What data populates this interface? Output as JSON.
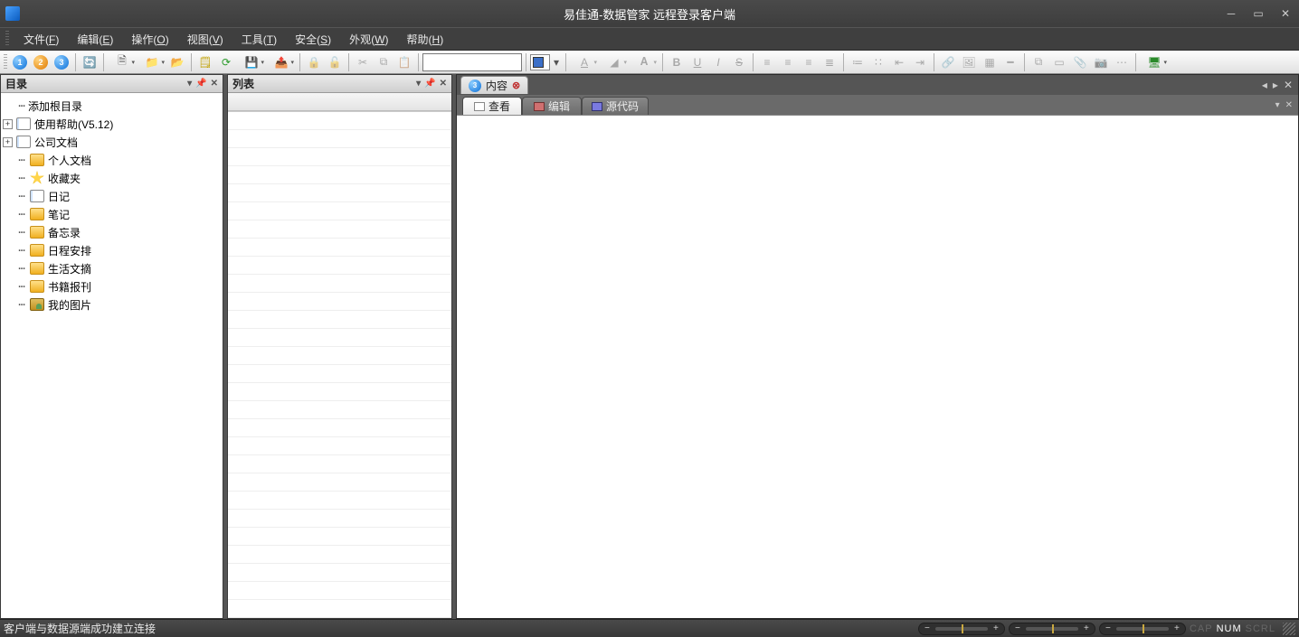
{
  "window": {
    "title": "易佳通-数据管家 远程登录客户端"
  },
  "menu": {
    "file": {
      "label": "文件",
      "accel": "F"
    },
    "edit": {
      "label": "编辑",
      "accel": "E"
    },
    "operate": {
      "label": "操作",
      "accel": "O"
    },
    "view": {
      "label": "视图",
      "accel": "V"
    },
    "tool": {
      "label": "工具",
      "accel": "T"
    },
    "safety": {
      "label": "安全",
      "accel": "S"
    },
    "appearance": {
      "label": "外观",
      "accel": "W"
    },
    "help": {
      "label": "帮助",
      "accel": "H"
    }
  },
  "toolbar": {
    "btn1": "1",
    "btn2": "2",
    "btn3": "3"
  },
  "panels": {
    "tree_title": "目录",
    "list_title": "列表",
    "content_title": "内容"
  },
  "tree": {
    "items": [
      {
        "label": "添加根目录",
        "icon": "none",
        "depth": 1,
        "expander": ""
      },
      {
        "label": "使用帮助(V5.12)",
        "icon": "doc",
        "depth": 0,
        "expander": "+"
      },
      {
        "label": "公司文档",
        "icon": "doc",
        "depth": 0,
        "expander": "+"
      },
      {
        "label": "个人文档",
        "icon": "folder",
        "depth": 1,
        "expander": ""
      },
      {
        "label": "收藏夹",
        "icon": "star",
        "depth": 1,
        "expander": ""
      },
      {
        "label": "日记",
        "icon": "doc",
        "depth": 1,
        "expander": ""
      },
      {
        "label": "笔记",
        "icon": "folder",
        "depth": 1,
        "expander": ""
      },
      {
        "label": "备忘录",
        "icon": "folder",
        "depth": 1,
        "expander": ""
      },
      {
        "label": "日程安排",
        "icon": "folder",
        "depth": 1,
        "expander": ""
      },
      {
        "label": "生活文摘",
        "icon": "folder",
        "depth": 1,
        "expander": ""
      },
      {
        "label": "书籍报刊",
        "icon": "folder",
        "depth": 1,
        "expander": ""
      },
      {
        "label": "我的图片",
        "icon": "pic",
        "depth": 1,
        "expander": ""
      }
    ]
  },
  "content_tabs": {
    "main": "内容",
    "sub": [
      {
        "label": "查看",
        "active": true
      },
      {
        "label": "编辑",
        "active": false
      },
      {
        "label": "源代码",
        "active": false
      }
    ]
  },
  "status": {
    "text": "客户端与数据源端成功建立连接",
    "cap": "CAP",
    "num": "NUM",
    "scrl": "SCRL"
  }
}
